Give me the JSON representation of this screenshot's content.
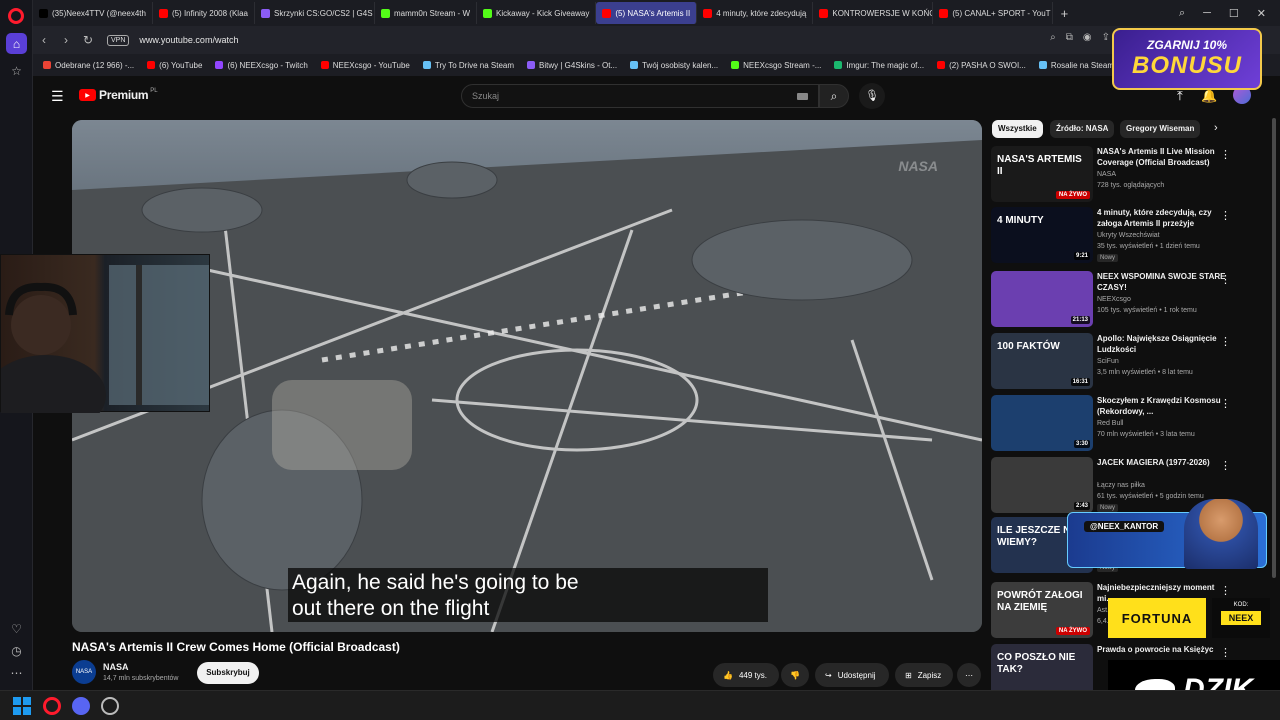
{
  "tabs": [
    {
      "label": "(35)Neex4TTV (@neex4th",
      "color": "#000000"
    },
    {
      "label": "(5) Infinity 2008 (Klaa",
      "color": "#ff0000"
    },
    {
      "label": "Skrzynki CS:GO/CS2 | G4S",
      "color": "#8b5cf6"
    },
    {
      "label": "mamm0n Stream - W",
      "color": "#53fc18"
    },
    {
      "label": "Kickaway - Kick Giveaway",
      "color": "#53fc18"
    },
    {
      "label": "(5) NASA's Artemis II",
      "color": "#ff0000",
      "active": true
    },
    {
      "label": "4 minuty, które zdecydują",
      "color": "#ff0000"
    },
    {
      "label": "KONTROWERSJE W KOŃC",
      "color": "#ff0000"
    },
    {
      "label": "(5) CANAL+ SPORT - YouT",
      "color": "#ff0000"
    }
  ],
  "address": {
    "url": "www.youtube.com/watch",
    "vpn": "VPN"
  },
  "bookmarks": [
    {
      "label": "Odebrane (12 966) -...",
      "color": "#ea4335"
    },
    {
      "label": "(6) YouTube",
      "color": "#ff0000"
    },
    {
      "label": "(6) NEEXcsgo - Twitch",
      "color": "#9146ff"
    },
    {
      "label": "NEEXcsgo - YouTube",
      "color": "#ff0000"
    },
    {
      "label": "Try To Drive na Steam",
      "color": "#66c0f4"
    },
    {
      "label": "Bitwy | G4Skins - Ot...",
      "color": "#8b5cf6"
    },
    {
      "label": "Twój osobisty kalen...",
      "color": "#66c0f4"
    },
    {
      "label": "NEEXcsgo Stream -...",
      "color": "#53fc18"
    },
    {
      "label": "Imgur: The magic of...",
      "color": "#1bb76e"
    },
    {
      "label": "(2) PASHA O SWOI...",
      "color": "#ff0000"
    },
    {
      "label": "Rosalie na Steam",
      "color": "#66c0f4"
    }
  ],
  "yt": {
    "logo": "Premium",
    "region": "PL",
    "search_placeholder": "Szukaj",
    "notif_count": "9+"
  },
  "video": {
    "caption_line1": "Again, he said he's going to be",
    "caption_line2": "out there on the flight",
    "watermark": "NASA",
    "title": "NASA's Artemis II Crew Comes Home (Official Broadcast)",
    "channel": "NASA",
    "subs": "14,7 mln subskrybentów",
    "subscribe": "Subskrybuj",
    "likes": "449 tys.",
    "share": "Udostępnij",
    "save": "Zapisz"
  },
  "chips": [
    "Wszystkie",
    "Źródło: NASA",
    "Gregory Wiseman"
  ],
  "recs": [
    {
      "title": "NASA's Artemis II Live Mission Coverage (Official Broadcast)",
      "channel": "NASA",
      "meta": "728 tys. oglądających",
      "badge": "NA ŻYWO",
      "thumb": "#1a1a1a",
      "thumb_text": "NASA'S ARTEMIS II"
    },
    {
      "title": "4 minuty, które zdecydują, czy załoga Artemis II przeżyje",
      "channel": "Ukryty Wszechświat",
      "meta": "35 tys. wyświetleń • 1 dzień temu",
      "tag": "Nowy",
      "duration": "9:21",
      "thumb": "#0b0f1e",
      "thumb_text": "4 MINUTY"
    },
    {
      "title": "NEEX WSPOMINA SWOJE STARE CZASY!",
      "channel": "NEEXcsgo",
      "meta": "105 tys. wyświetleń • 1 rok temu",
      "duration": "21:13",
      "thumb": "#6b3fb0",
      "thumb_text": ""
    },
    {
      "title": "Apollo: Największe Osiągnięcie Ludzkości",
      "channel": "SciFun",
      "meta": "3,5 mln wyświetleń • 8 lat temu",
      "duration": "16:31",
      "thumb": "#2a3444",
      "thumb_text": "100 FAKTÓW"
    },
    {
      "title": "Skoczyłem z Krawędzi Kosmosu (Rekordowy, ...",
      "channel": "Red Bull",
      "meta": "70 mln wyświetleń • 3 lata temu",
      "duration": "3:30",
      "thumb": "#1c3f6e",
      "thumb_text": ""
    },
    {
      "title": "JACEK MAGIERA (1977-2026)",
      "channel": "Łączy nas piłka",
      "meta": "61 tys. wyświetleń • 5 godzin temu",
      "tag": "Nowy",
      "duration": "2:43",
      "thumb": "#3a3a3a",
      "thumb_text": ""
    },
    {
      "title": "",
      "channel": "",
      "meta": "",
      "tag": "Nowy",
      "thumb": "#23324f",
      "thumb_text": "ILE JESZCZE NIE WIEMY?"
    },
    {
      "title": "Najniebezpieczniejszy moment mi...",
      "channel": "Ast...",
      "meta": "6,4...",
      "badge": "NA ŻYWO",
      "thumb": "#3c3c3c",
      "thumb_text": "POWRÓT ZAŁOGI NA ZIEMIĘ"
    },
    {
      "title": "Prawda o powrocie na Księżyc",
      "channel": "",
      "meta": "",
      "thumb": "#2b2b3a",
      "thumb_text": "CO POSZŁO NIE TAK?"
    }
  ],
  "overlays": {
    "bonus_l1": "ZGARNIJ 10%",
    "bonus_l2": "BONUSU",
    "kantor_handle": "@NEEX_KANTOR",
    "fortuna": "FORTUNA",
    "kod_label": "KOD:",
    "kod": "NEEX",
    "dzik": "DZIK"
  }
}
